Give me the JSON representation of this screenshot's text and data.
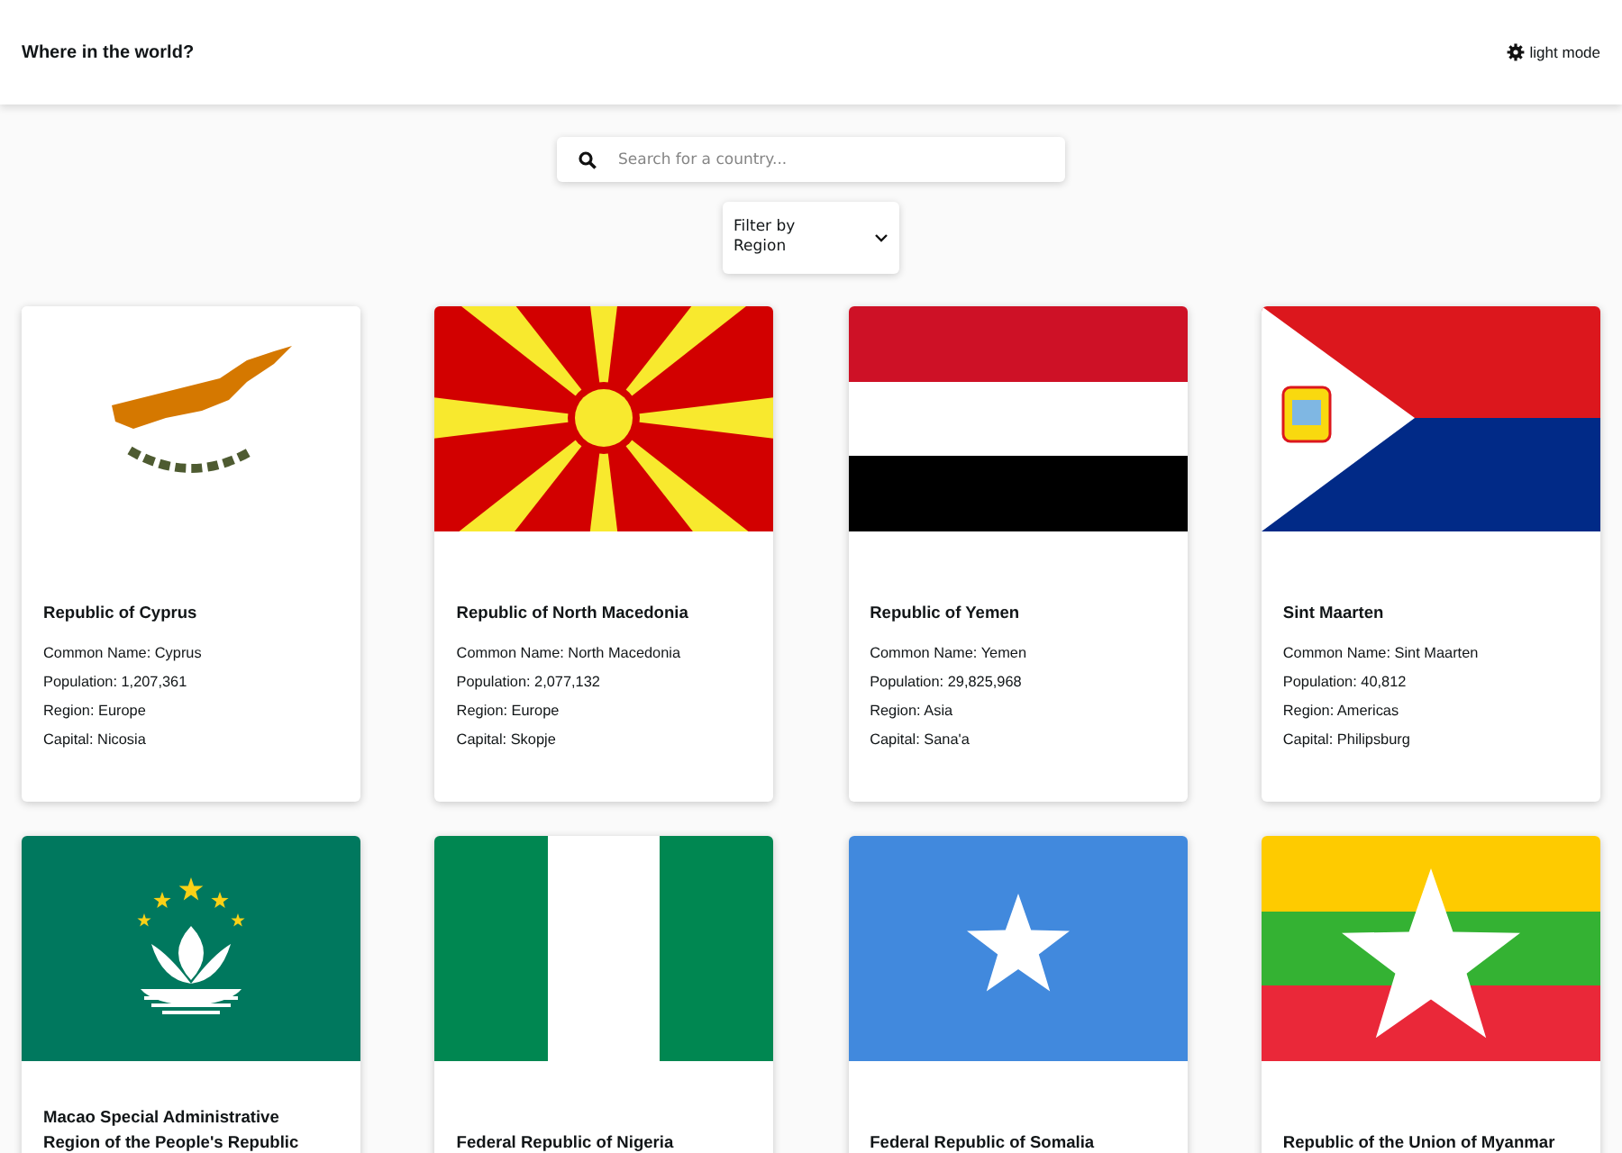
{
  "header": {
    "title": "Where in the world?",
    "theme_toggle": "light mode"
  },
  "search": {
    "placeholder": "Search for a country..."
  },
  "filter": {
    "label": "Filter by Region"
  },
  "countries": [
    {
      "flag": {
        "kind": "cyprus"
      },
      "official_name": "Republic of Cyprus",
      "details": [
        "Common Name: Cyprus",
        "Population: 1,207,361",
        "Region: Europe",
        "Capital: Nicosia"
      ]
    },
    {
      "flag": {
        "kind": "macedonia"
      },
      "official_name": "Republic of North Macedonia",
      "details": [
        "Common Name: North Macedonia",
        "Population: 2,077,132",
        "Region: Europe",
        "Capital: Skopje"
      ]
    },
    {
      "flag": {
        "kind": "yemen"
      },
      "official_name": "Republic of Yemen",
      "details": [
        "Common Name: Yemen",
        "Population: 29,825,968",
        "Region: Asia",
        "Capital: Sana'a"
      ]
    },
    {
      "flag": {
        "kind": "sint-maarten"
      },
      "official_name": "Sint Maarten",
      "details": [
        "Common Name: Sint Maarten",
        "Population: 40,812",
        "Region: Americas",
        "Capital: Philipsburg"
      ]
    },
    {
      "flag": {
        "kind": "macao"
      },
      "official_name": "Macao Special Administrative Region of the People's Republic"
    },
    {
      "flag": {
        "kind": "nigeria"
      },
      "official_name": "Federal Republic of Nigeria"
    },
    {
      "flag": {
        "kind": "somalia"
      },
      "official_name": "Federal Republic of Somalia"
    },
    {
      "flag": {
        "kind": "myanmar"
      },
      "official_name": "Republic of the Union of Myanmar"
    }
  ]
}
